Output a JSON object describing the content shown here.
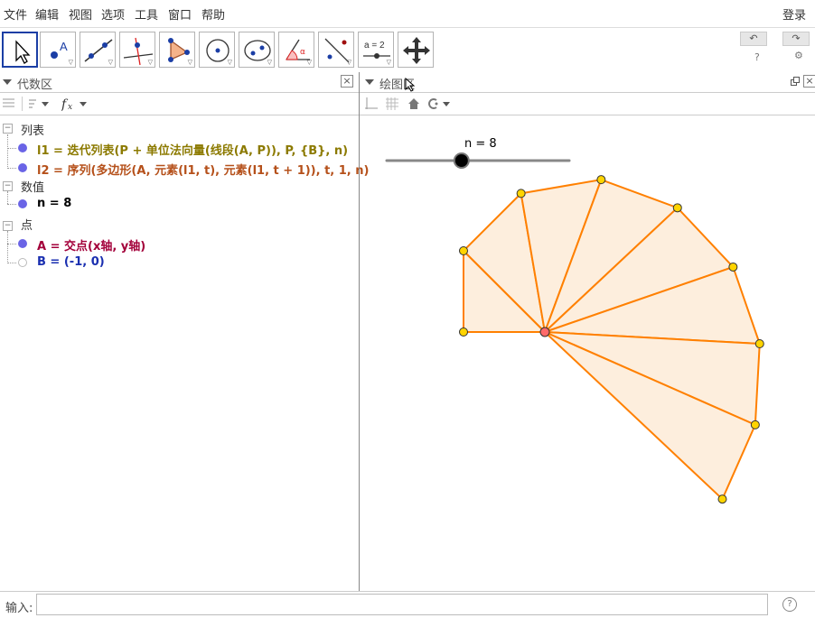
{
  "menu": {
    "items": [
      "文件",
      "编辑",
      "视图",
      "选项",
      "工具",
      "窗口",
      "帮助"
    ],
    "login": "登录"
  },
  "toolbar": {
    "tools": [
      {
        "icon": "move-arrow-icon",
        "active": true
      },
      {
        "icon": "point-icon",
        "label": "A"
      },
      {
        "icon": "line-icon"
      },
      {
        "icon": "perpendicular-line-icon"
      },
      {
        "icon": "polygon-icon"
      },
      {
        "icon": "circle-center-icon"
      },
      {
        "icon": "ellipse-icon"
      },
      {
        "icon": "angle-icon",
        "label": "α"
      },
      {
        "icon": "reflect-icon"
      },
      {
        "icon": "slider-icon",
        "label": "a = 2"
      },
      {
        "icon": "move-view-icon"
      }
    ],
    "undo": "↶",
    "redo": "↷",
    "help": "?",
    "settings": "⚙"
  },
  "algebra": {
    "title": "代数区",
    "categories": [
      {
        "name": "列表",
        "entries": [
          {
            "text": "l1 = 迭代列表(P + 单位法向量(线段(A, P)), P, {B}, n)",
            "color": "#8c7a00",
            "visible": true
          },
          {
            "text": "l2 = 序列(多边形(A, 元素(l1, t), 元素(l1, t + 1)), t, 1, n)",
            "color": "#b5501a",
            "visible": true
          }
        ]
      },
      {
        "name": "数值",
        "entries": [
          {
            "text": "n = 8",
            "color": "#000000",
            "visible": true
          }
        ]
      },
      {
        "name": "点",
        "entries": [
          {
            "text": "A = 交点(x轴, y轴)",
            "color": "#a3003a",
            "visible": true
          },
          {
            "text": "B = (-1, 0)",
            "color": "#1a2fb0",
            "visible": false
          }
        ]
      }
    ]
  },
  "graphics": {
    "title": "绘图区",
    "slider_label": "n = 8",
    "slider_value": 8,
    "slider_min": 1,
    "slider_max": 20,
    "polygon_color": "#ff8000",
    "fill_color": "#fdeedd",
    "point_color": "#ffd400",
    "center_point_color": "#ff6a6a",
    "iterations": 8
  },
  "input": {
    "label": "输入:",
    "placeholder": "",
    "help": "?"
  }
}
